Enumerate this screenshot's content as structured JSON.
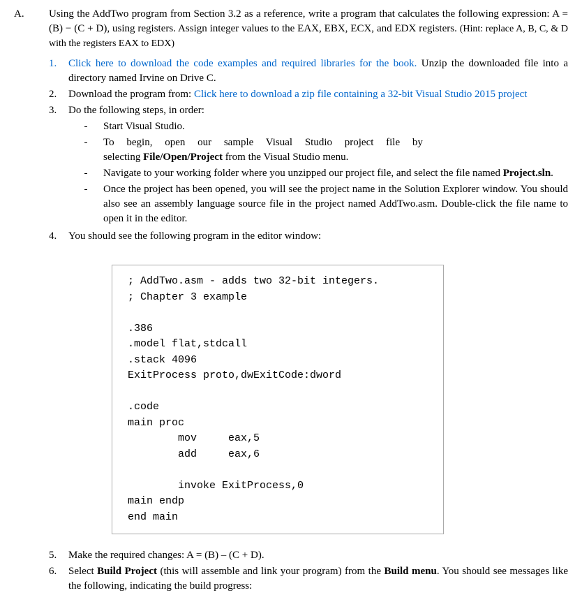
{
  "sectionA": {
    "marker": "A.",
    "text": "Using the AddTwo program from Section 3.2 as a reference, write a program that calculates the following expression: A = (B) − (C + D), using registers. Assign integer values to the EAX, EBX, ECX, and EDX registers. ",
    "hint": "(Hint: replace A, B, C, & D with the registers EAX to EDX)"
  },
  "items": {
    "1": {
      "num": "1.",
      "link": "Click here to download the code examples and required libraries for the book.",
      "rest": " Unzip the downloaded file into a directory named Irvine on Drive C."
    },
    "2": {
      "num": "2.",
      "pre": "Download the program from: ",
      "link": "Click here to download a zip file containing a 32-bit Visual Studio 2015 project"
    },
    "3": {
      "num": "3.",
      "text": "Do the following steps, in order:",
      "sub": {
        "a": "Start Visual Studio.",
        "b_line1": "To begin, open our sample Visual Studio project file by",
        "b_line2_pre": "selecting ",
        "b_line2_bold": "File/Open/Project",
        "b_line2_post": " from the Visual Studio menu.",
        "c_pre": "Navigate to your working folder where you unzipped our project file, and select the file named ",
        "c_bold": "Project.sln",
        "c_post": ".",
        "d": "Once the project has been opened, you will see the project name in the Solution Explorer window. You should also see an assembly language source file in the project named AddTwo.asm. Double-click the file name to open it in the editor."
      }
    },
    "4": {
      "num": "4.",
      "text": "You should see the following program in the editor window:"
    },
    "5": {
      "num": "5.",
      "text": "Make the required changes: A = (B) – (C + D)."
    },
    "6": {
      "num": "6.",
      "pre": "Select ",
      "bold1": "Build Project",
      "mid": " (this will assemble and link your program) from the ",
      "bold2": "Build menu",
      "post": ". You should see messages like the following, indicating the build progress:"
    }
  },
  "code": "; AddTwo.asm - adds two 32-bit integers.\n; Chapter 3 example\n\n.386\n.model flat,stdcall\n.stack 4096\nExitProcess proto,dwExitCode:dword\n\n.code\nmain proc\n        mov     eax,5\n        add     eax,6\n\n        invoke ExitProcess,0\nmain endp\nend main"
}
